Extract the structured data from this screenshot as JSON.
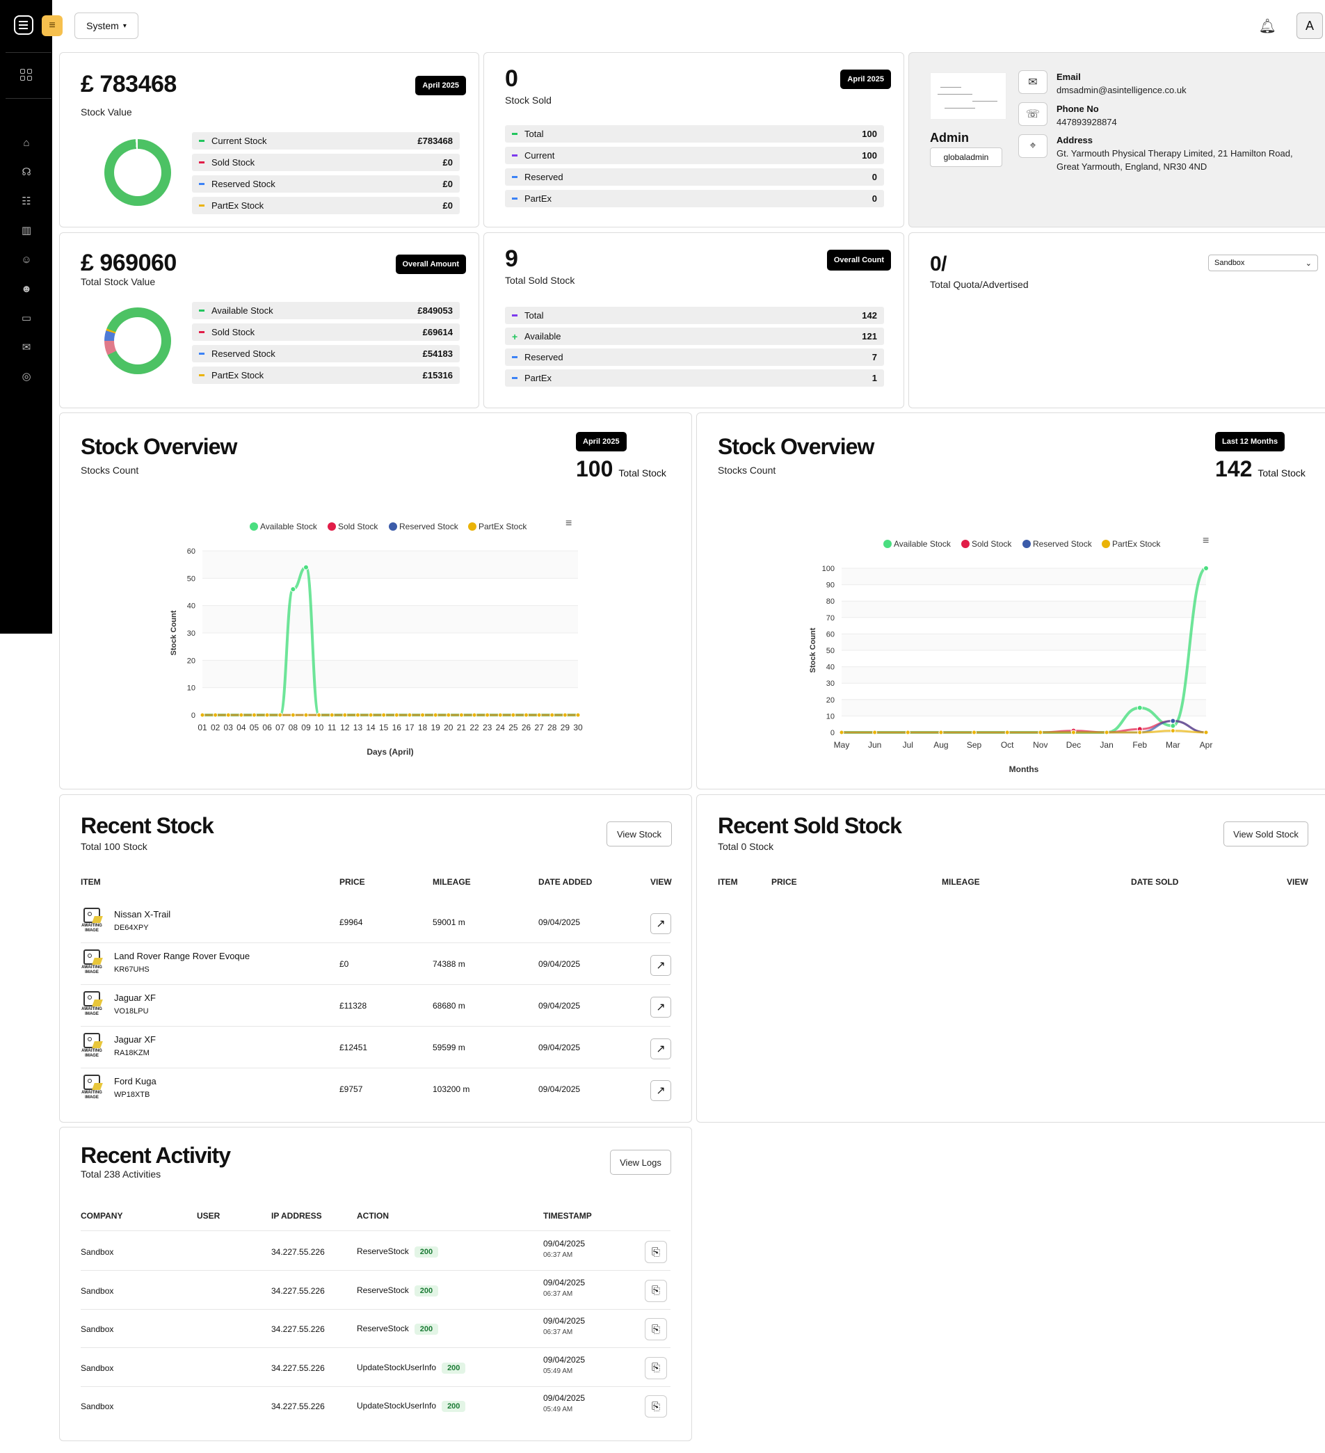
{
  "topbar": {
    "system_label": "System",
    "avatar_letter": "A"
  },
  "card_stock_value": {
    "amount": "£ 783468",
    "label": "Stock Value",
    "badge": "April 2025",
    "rows": [
      {
        "label": "Current Stock",
        "value": "£783468",
        "color": "#22c55e"
      },
      {
        "label": "Sold Stock",
        "value": "£0",
        "color": "#e11d48"
      },
      {
        "label": "Reserved Stock",
        "value": "£0",
        "color": "#3b82f6"
      },
      {
        "label": "PartEx Stock",
        "value": "£0",
        "color": "#eab308"
      }
    ]
  },
  "card_stock_sold": {
    "amount": "0",
    "label": "Stock Sold",
    "badge": "April 2025",
    "rows": [
      {
        "label": "Total",
        "value": "100",
        "color": "#22c55e"
      },
      {
        "label": "Current",
        "value": "100",
        "color": "#7c3aed"
      },
      {
        "label": "Reserved",
        "value": "0",
        "color": "#3b82f6"
      },
      {
        "label": "PartEx",
        "value": "0",
        "color": "#3b82f6"
      }
    ]
  },
  "profile": {
    "name": "Admin",
    "username": "globaladmin",
    "email_label": "Email",
    "email": "dmsadmin@asintelligence.co.uk",
    "phone_label": "Phone No",
    "phone": "447893928874",
    "address_label": "Address",
    "address_line1": "Gt. Yarmouth Physical Therapy Limited, 21 Hamilton Road,",
    "address_line2": "Great Yarmouth, England, NR30 4ND"
  },
  "card_total_value": {
    "amount": "£ 969060",
    "label": "Total Stock Value",
    "badge": "Overall Amount",
    "rows": [
      {
        "label": "Available Stock",
        "value": "£849053",
        "color": "#22c55e"
      },
      {
        "label": "Sold Stock",
        "value": "£69614",
        "color": "#e11d48"
      },
      {
        "label": "Reserved Stock",
        "value": "£54183",
        "color": "#3b82f6"
      },
      {
        "label": "PartEx Stock",
        "value": "£15316",
        "color": "#eab308"
      }
    ]
  },
  "card_total_sold": {
    "amount": "9",
    "label": "Total Sold Stock",
    "badge": "Overall Count",
    "rows": [
      {
        "label": "Total",
        "value": "142",
        "color": "#7c3aed",
        "symbol": "-"
      },
      {
        "label": "Available",
        "value": "121",
        "color": "#22c55e",
        "symbol": "+"
      },
      {
        "label": "Reserved",
        "value": "7",
        "color": "#3b82f6",
        "symbol": "-"
      },
      {
        "label": "PartEx",
        "value": "1",
        "color": "#3b82f6",
        "symbol": "-"
      }
    ]
  },
  "card_quota": {
    "amount": "0/",
    "label": "Total Quota/Advertised",
    "select": "Sandbox"
  },
  "overview_month": {
    "title": "Stock Overview",
    "subtitle": "Stocks Count",
    "badge": "April 2025",
    "total": "100",
    "total_label": "Total Stock"
  },
  "overview_year": {
    "title": "Stock Overview",
    "subtitle": "Stocks Count",
    "badge": "Last 12 Months",
    "total": "142",
    "total_label": "Total Stock"
  },
  "chart_data": [
    {
      "type": "line",
      "xlabel": "Days (April)",
      "ylabel": "Stock Count",
      "ylim": [
        0,
        60
      ],
      "yticks": [
        0,
        10,
        20,
        30,
        40,
        50,
        60
      ],
      "categories": [
        "01",
        "02",
        "03",
        "04",
        "05",
        "06",
        "07",
        "08",
        "09",
        "10",
        "11",
        "12",
        "13",
        "14",
        "15",
        "16",
        "17",
        "18",
        "19",
        "20",
        "21",
        "22",
        "23",
        "24",
        "25",
        "26",
        "27",
        "28",
        "29",
        "30"
      ],
      "legend": [
        "Available Stock",
        "Sold Stock",
        "Reserved Stock",
        "PartEx Stock"
      ],
      "legend_position": "top",
      "series": [
        {
          "name": "Available Stock",
          "color": "#4ade80",
          "values": [
            0,
            0,
            0,
            0,
            0,
            0,
            0,
            46,
            54,
            0,
            0,
            0,
            0,
            0,
            0,
            0,
            0,
            0,
            0,
            0,
            0,
            0,
            0,
            0,
            0,
            0,
            0,
            0,
            0,
            0
          ]
        },
        {
          "name": "Sold Stock",
          "color": "#e11d48",
          "values": [
            0,
            0,
            0,
            0,
            0,
            0,
            0,
            0,
            0,
            0,
            0,
            0,
            0,
            0,
            0,
            0,
            0,
            0,
            0,
            0,
            0,
            0,
            0,
            0,
            0,
            0,
            0,
            0,
            0,
            0
          ]
        },
        {
          "name": "Reserved Stock",
          "color": "#3b5ba9",
          "values": [
            0,
            0,
            0,
            0,
            0,
            0,
            0,
            0,
            0,
            0,
            0,
            0,
            0,
            0,
            0,
            0,
            0,
            0,
            0,
            0,
            0,
            0,
            0,
            0,
            0,
            0,
            0,
            0,
            0,
            0
          ]
        },
        {
          "name": "PartEx Stock",
          "color": "#eab308",
          "values": [
            0,
            0,
            0,
            0,
            0,
            0,
            0,
            0,
            0,
            0,
            0,
            0,
            0,
            0,
            0,
            0,
            0,
            0,
            0,
            0,
            0,
            0,
            0,
            0,
            0,
            0,
            0,
            0,
            0,
            0
          ]
        }
      ]
    },
    {
      "type": "line",
      "xlabel": "Months",
      "ylabel": "Stock Count",
      "ylim": [
        0,
        100
      ],
      "yticks": [
        0,
        10,
        20,
        30,
        40,
        50,
        60,
        70,
        80,
        90,
        100
      ],
      "categories": [
        "May",
        "Jun",
        "Jul",
        "Aug",
        "Sep",
        "Oct",
        "Nov",
        "Dec",
        "Jan",
        "Feb",
        "Mar",
        "Apr"
      ],
      "legend": [
        "Available Stock",
        "Sold Stock",
        "Reserved Stock",
        "PartEx Stock"
      ],
      "legend_position": "top",
      "series": [
        {
          "name": "Available Stock",
          "color": "#4ade80",
          "values": [
            0,
            0,
            0,
            0,
            0,
            0,
            0,
            0,
            0,
            15,
            4,
            100
          ]
        },
        {
          "name": "Sold Stock",
          "color": "#e11d48",
          "values": [
            0,
            0,
            0,
            0,
            0,
            0,
            0,
            1,
            0,
            2,
            7,
            0
          ]
        },
        {
          "name": "Reserved Stock",
          "color": "#3b5ba9",
          "values": [
            0,
            0,
            0,
            0,
            0,
            0,
            0,
            0,
            0,
            0,
            7,
            0
          ]
        },
        {
          "name": "PartEx Stock",
          "color": "#eab308",
          "values": [
            0,
            0,
            0,
            0,
            0,
            0,
            0,
            0,
            0,
            0,
            1,
            0
          ]
        }
      ]
    }
  ],
  "recent_stock": {
    "title": "Recent Stock",
    "subtitle": "Total 100 Stock",
    "button": "View Stock",
    "headers": [
      "ITEM",
      "PRICE",
      "MILEAGE",
      "DATE ADDED",
      "VIEW"
    ],
    "thumb_text": "AWAITING IMAGE",
    "rows": [
      {
        "name": "Nissan X-Trail",
        "reg": "DE64XPY",
        "price": "£9964",
        "mileage": "59001 m",
        "date": "09/04/2025"
      },
      {
        "name": "Land Rover Range Rover Evoque",
        "reg": "KR67UHS",
        "price": "£0",
        "mileage": "74388 m",
        "date": "09/04/2025"
      },
      {
        "name": "Jaguar XF",
        "reg": "VO18LPU",
        "price": "£11328",
        "mileage": "68680 m",
        "date": "09/04/2025"
      },
      {
        "name": "Jaguar XF",
        "reg": "RA18KZM",
        "price": "£12451",
        "mileage": "59599 m",
        "date": "09/04/2025"
      },
      {
        "name": "Ford Kuga",
        "reg": "WP18XTB",
        "price": "£9757",
        "mileage": "103200 m",
        "date": "09/04/2025"
      }
    ]
  },
  "recent_sold": {
    "title": "Recent Sold Stock",
    "subtitle": "Total 0 Stock",
    "button": "View Sold Stock",
    "headers": [
      "ITEM",
      "PRICE",
      "MILEAGE",
      "DATE SOLD",
      "VIEW"
    ]
  },
  "recent_activity": {
    "title": "Recent Activity",
    "subtitle": "Total 238 Activities",
    "button": "View Logs",
    "headers": [
      "COMPANY",
      "USER",
      "IP ADDRESS",
      "ACTION",
      "TIMESTAMP"
    ],
    "rows": [
      {
        "company": "Sandbox",
        "user": "",
        "ip": "34.227.55.226",
        "action": "ReserveStock",
        "code": "200",
        "date": "09/04/2025",
        "time": "06:37 AM"
      },
      {
        "company": "Sandbox",
        "user": "",
        "ip": "34.227.55.226",
        "action": "ReserveStock",
        "code": "200",
        "date": "09/04/2025",
        "time": "06:37 AM"
      },
      {
        "company": "Sandbox",
        "user": "",
        "ip": "34.227.55.226",
        "action": "ReserveStock",
        "code": "200",
        "date": "09/04/2025",
        "time": "06:37 AM"
      },
      {
        "company": "Sandbox",
        "user": "",
        "ip": "34.227.55.226",
        "action": "UpdateStockUserInfo",
        "code": "200",
        "date": "09/04/2025",
        "time": "05:49 AM"
      },
      {
        "company": "Sandbox",
        "user": "",
        "ip": "34.227.55.226",
        "action": "UpdateStockUserInfo",
        "code": "200",
        "date": "09/04/2025",
        "time": "05:49 AM"
      }
    ]
  }
}
